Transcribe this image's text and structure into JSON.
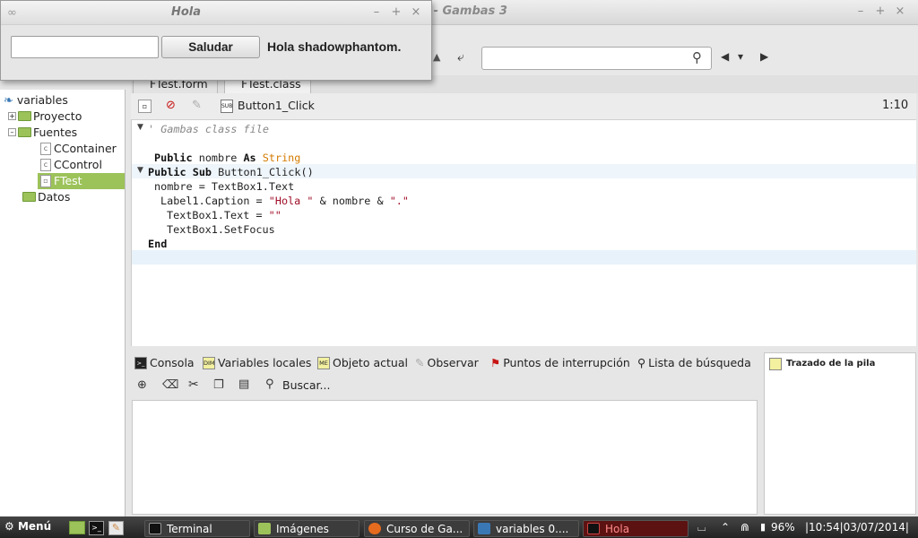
{
  "ide": {
    "title": "1 - Gambas 3",
    "window_controls": [
      "–",
      "+",
      "×"
    ],
    "search_placeholder": "",
    "nav_back": "◀",
    "nav_menu": "▾",
    "nav_forward": "▶"
  },
  "project_tree": {
    "root": "variables",
    "items": [
      {
        "label": "Proyecto",
        "type": "folder"
      },
      {
        "label": "Fuentes",
        "type": "folder"
      },
      {
        "label": "CContainer",
        "type": "class"
      },
      {
        "label": "CControl",
        "type": "class"
      },
      {
        "label": "FTest",
        "type": "form",
        "selected": true
      },
      {
        "label": "Datos",
        "type": "folder"
      }
    ]
  },
  "editor": {
    "tabs": [
      {
        "label": "FTest.form"
      },
      {
        "label": "FTest.class",
        "active": true
      }
    ],
    "procedure": "Button1_Click",
    "cursor_position": "1:10",
    "code": {
      "l1": "' Gambas class file",
      "l3_kw1": "Public",
      "l3_var": " nombre ",
      "l3_kw2": "As",
      "l3_type": " String",
      "l4_kw": "Public Sub",
      "l4_rest": " Button1_Click()",
      "l5": "nombre = TextBox1.Text",
      "l6_a": "Label1.Caption = ",
      "l6_s1": "\"Hola \"",
      "l6_b": " & nombre & ",
      "l6_s2": "\".\"",
      "l7_a": "TextBox1.Text = ",
      "l7_s": "\"\"",
      "l8": "TextBox1.SetFocus",
      "l9": "End"
    }
  },
  "bottom_panel": {
    "tabs": [
      {
        "label": "Consola",
        "icon": "terminal-icon"
      },
      {
        "label": "Variables locales",
        "icon": "dim-icon"
      },
      {
        "label": "Objeto actual",
        "icon": "me-icon"
      },
      {
        "label": "Observar",
        "icon": "brush-icon"
      },
      {
        "label": "Puntos de interrupción",
        "icon": "flag-icon"
      },
      {
        "label": "Lista de búsqueda",
        "icon": "search-icon"
      }
    ],
    "search_label": "Buscar...",
    "stack_title": "Trazado de la pila"
  },
  "dialog": {
    "title": "Hola",
    "input_value": "",
    "button_label": "Saludar",
    "greeting": "Hola shadowphantom."
  },
  "taskbar": {
    "menu_label": "Menú",
    "tasks": [
      {
        "label": "Terminal"
      },
      {
        "label": "Imágenes"
      },
      {
        "label": "Curso de Ga..."
      },
      {
        "label": "variables 0...."
      },
      {
        "label": "Hola"
      }
    ],
    "battery": "96%",
    "clock": "|10:54|03/07/2014|"
  },
  "colors": {
    "accent_green": "#9cc25a",
    "keyword": "#111111",
    "type": "#d47a00",
    "string": "#a0102a",
    "comment": "#888888"
  }
}
